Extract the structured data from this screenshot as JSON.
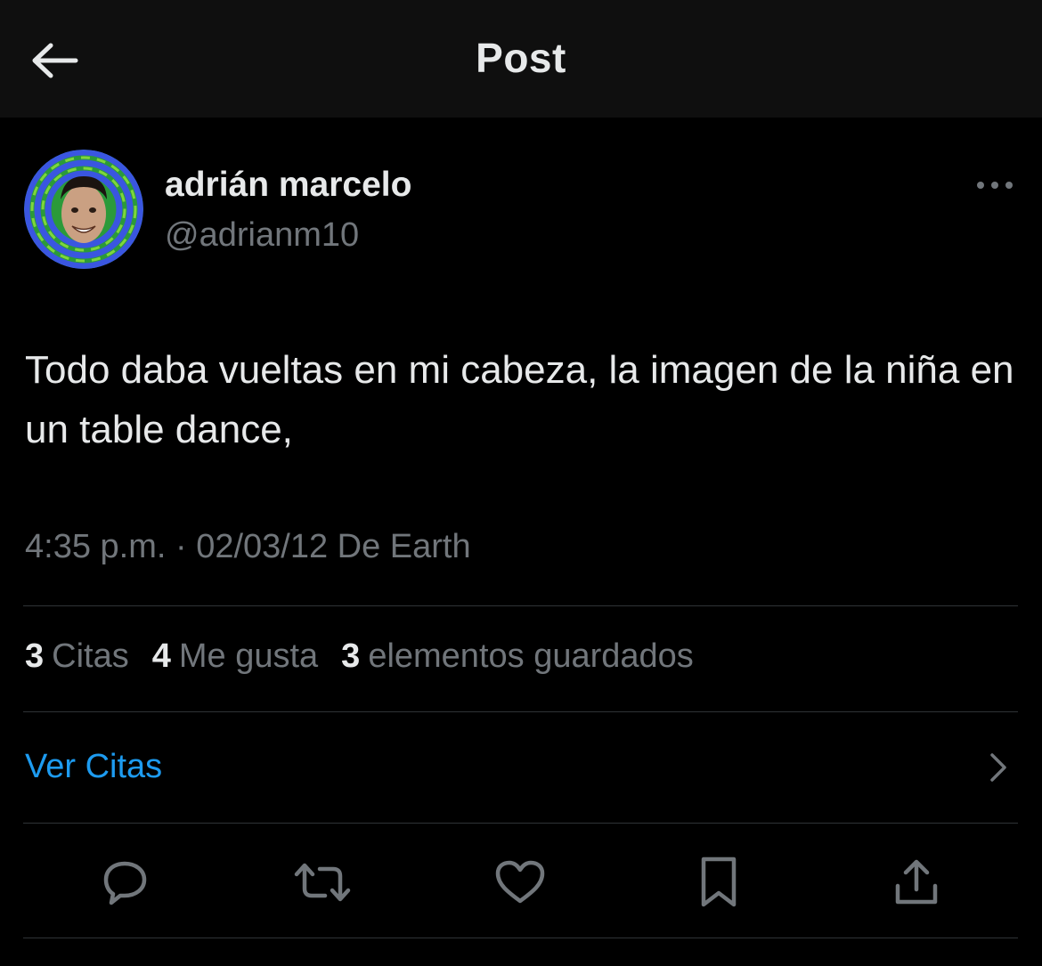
{
  "header": {
    "title": "Post",
    "back_icon": "arrow-left-icon"
  },
  "author": {
    "name": "adrián marcelo",
    "handle": "@adrianm10"
  },
  "post": {
    "text": "Todo daba vueltas en mi cabeza, la imagen de la niña en un table dance,",
    "meta": "4:35 p.m. · 02/03/12 De Earth"
  },
  "stats": [
    {
      "count": "3",
      "label": "Citas"
    },
    {
      "count": "4",
      "label": "Me gusta"
    },
    {
      "count": "3",
      "label": "elementos guardados"
    }
  ],
  "quotes_link": {
    "label": "Ver Citas"
  },
  "actions": [
    "reply-icon",
    "repost-icon",
    "like-icon",
    "bookmark-icon",
    "share-icon"
  ],
  "colors": {
    "background": "#000000",
    "header_background": "#0f0f0f",
    "primary_text": "#e7e9ea",
    "secondary_text": "#71767b",
    "link": "#1d9bf0",
    "divider": "#2f3336"
  }
}
